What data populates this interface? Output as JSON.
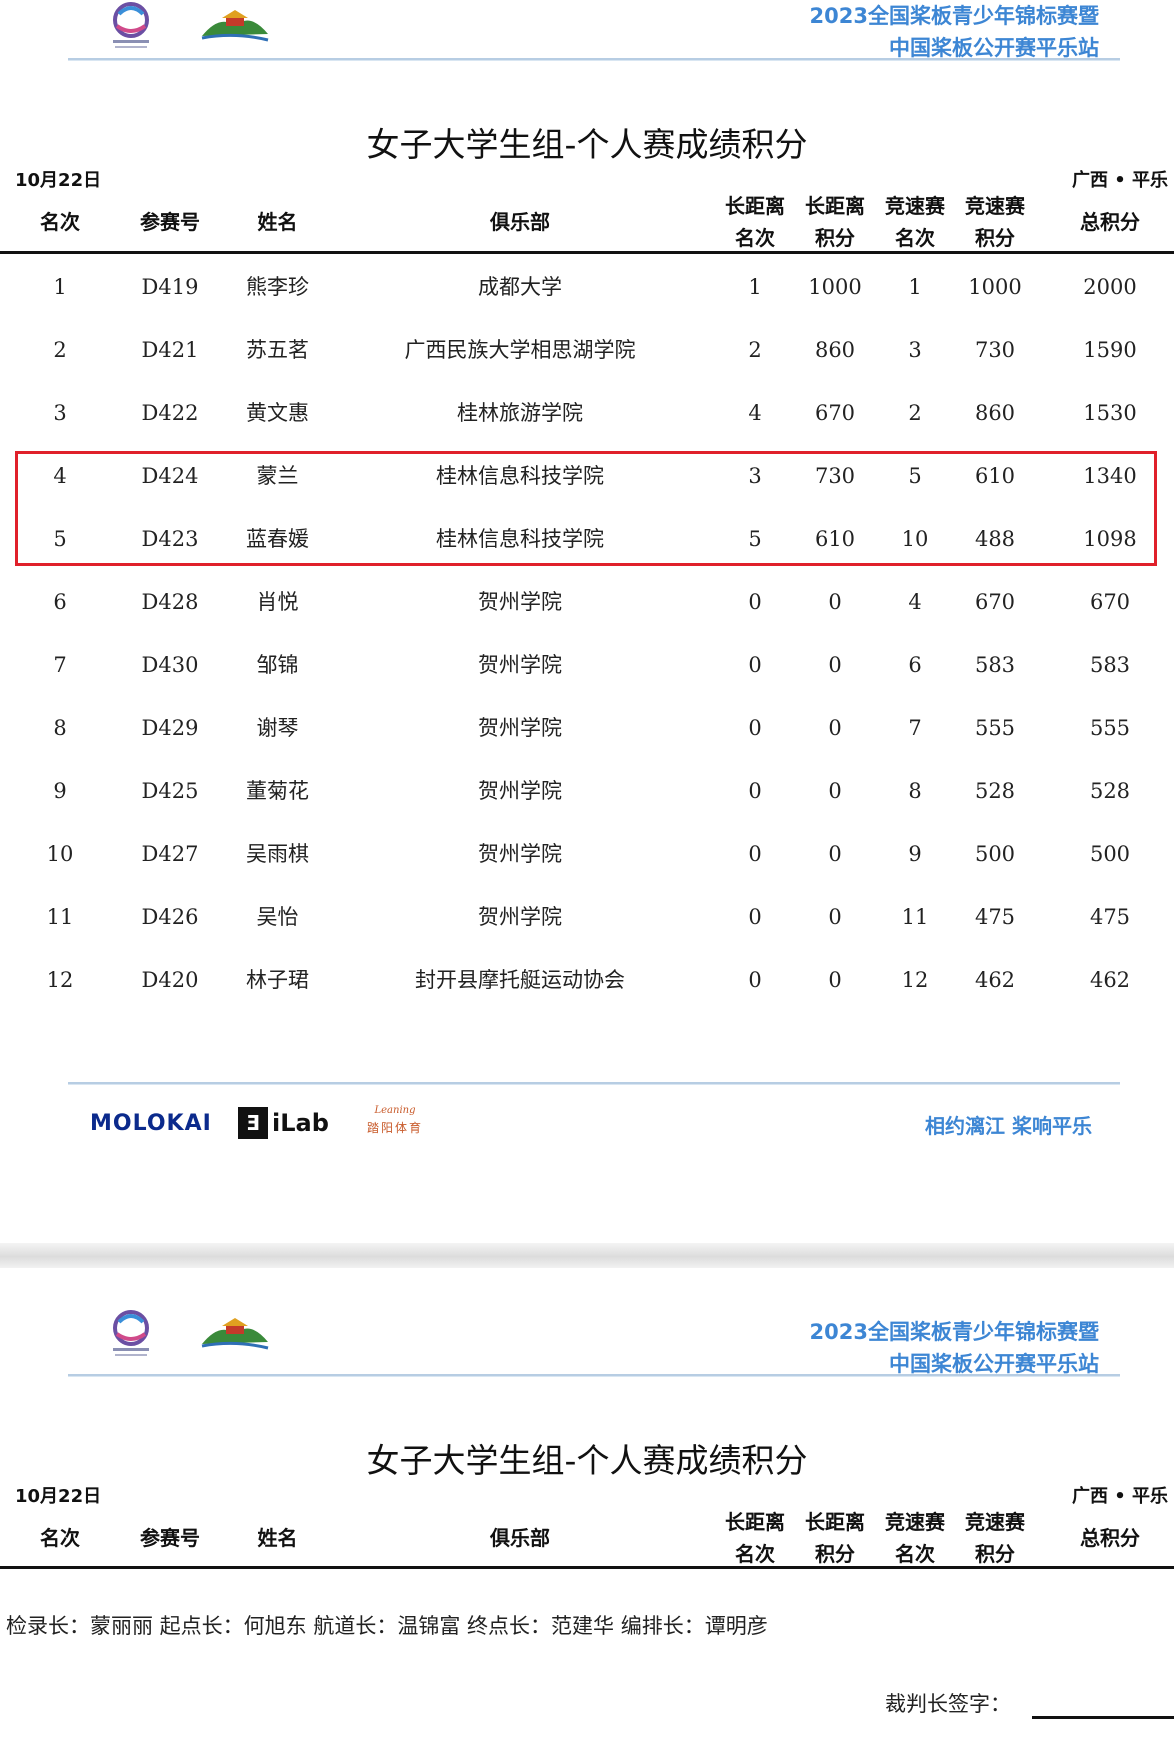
{
  "event": {
    "line1": "2023全国桨板青少年锦标赛暨",
    "line2": "中国桨板公开赛平乐站"
  },
  "report_title": "女子大学生组-个人赛成绩积分",
  "date": "10月22日",
  "place": "广西 • 平乐",
  "headers": {
    "rank": "名次",
    "bib": "参赛号",
    "name": "姓名",
    "club": "俱乐部",
    "long_rank": [
      "长距离",
      "名次"
    ],
    "long_points": [
      "长距离",
      "积分"
    ],
    "sprint_rank": [
      "竞速赛",
      "名次"
    ],
    "sprint_points": [
      "竞速赛",
      "积分"
    ],
    "total": "总积分"
  },
  "rows": [
    {
      "rank": "1",
      "bib": "D419",
      "name": "熊李珍",
      "club": "成都大学",
      "lr": "1",
      "lp": "1000",
      "sr": "1",
      "sp": "1000",
      "total": "2000"
    },
    {
      "rank": "2",
      "bib": "D421",
      "name": "苏五茗",
      "club": "广西民族大学相思湖学院",
      "lr": "2",
      "lp": "860",
      "sr": "3",
      "sp": "730",
      "total": "1590"
    },
    {
      "rank": "3",
      "bib": "D422",
      "name": "黄文惠",
      "club": "桂林旅游学院",
      "lr": "4",
      "lp": "670",
      "sr": "2",
      "sp": "860",
      "total": "1530"
    },
    {
      "rank": "4",
      "bib": "D424",
      "name": "蒙兰",
      "club": "桂林信息科技学院",
      "lr": "3",
      "lp": "730",
      "sr": "5",
      "sp": "610",
      "total": "1340"
    },
    {
      "rank": "5",
      "bib": "D423",
      "name": "蓝春媛",
      "club": "桂林信息科技学院",
      "lr": "5",
      "lp": "610",
      "sr": "10",
      "sp": "488",
      "total": "1098"
    },
    {
      "rank": "6",
      "bib": "D428",
      "name": "肖悦",
      "club": "贺州学院",
      "lr": "0",
      "lp": "0",
      "sr": "4",
      "sp": "670",
      "total": "670"
    },
    {
      "rank": "7",
      "bib": "D430",
      "name": "邹锦",
      "club": "贺州学院",
      "lr": "0",
      "lp": "0",
      "sr": "6",
      "sp": "583",
      "total": "583"
    },
    {
      "rank": "8",
      "bib": "D429",
      "name": "谢琴",
      "club": "贺州学院",
      "lr": "0",
      "lp": "0",
      "sr": "7",
      "sp": "555",
      "total": "555"
    },
    {
      "rank": "9",
      "bib": "D425",
      "name": "董菊花",
      "club": "贺州学院",
      "lr": "0",
      "lp": "0",
      "sr": "8",
      "sp": "528",
      "total": "528"
    },
    {
      "rank": "10",
      "bib": "D427",
      "name": "吴雨棋",
      "club": "贺州学院",
      "lr": "0",
      "lp": "0",
      "sr": "9",
      "sp": "500",
      "total": "500"
    },
    {
      "rank": "11",
      "bib": "D426",
      "name": "吴怡",
      "club": "贺州学院",
      "lr": "0",
      "lp": "0",
      "sr": "11",
      "sp": "475",
      "total": "475"
    },
    {
      "rank": "12",
      "bib": "D420",
      "name": "林子珺",
      "club": "封开县摩托艇运动协会",
      "lr": "0",
      "lp": "0",
      "sr": "12",
      "sp": "462",
      "total": "462"
    }
  ],
  "sponsors": {
    "molokai": "MOLOKAI",
    "ilab_mark": "Ǝ",
    "ilab": "iLab",
    "third_script": "Leaning",
    "third_cn": "踏阳体育"
  },
  "slogan": "相约漓江  桨响平乐",
  "officials": "检录长：蒙丽丽    起点长：何旭东    航道长：温锦富    终点长：范建华    编排长：谭明彦",
  "signature_label": "裁判长签字：",
  "colors": {
    "accent": "#3d86d4",
    "highlight": "#e0202a"
  }
}
